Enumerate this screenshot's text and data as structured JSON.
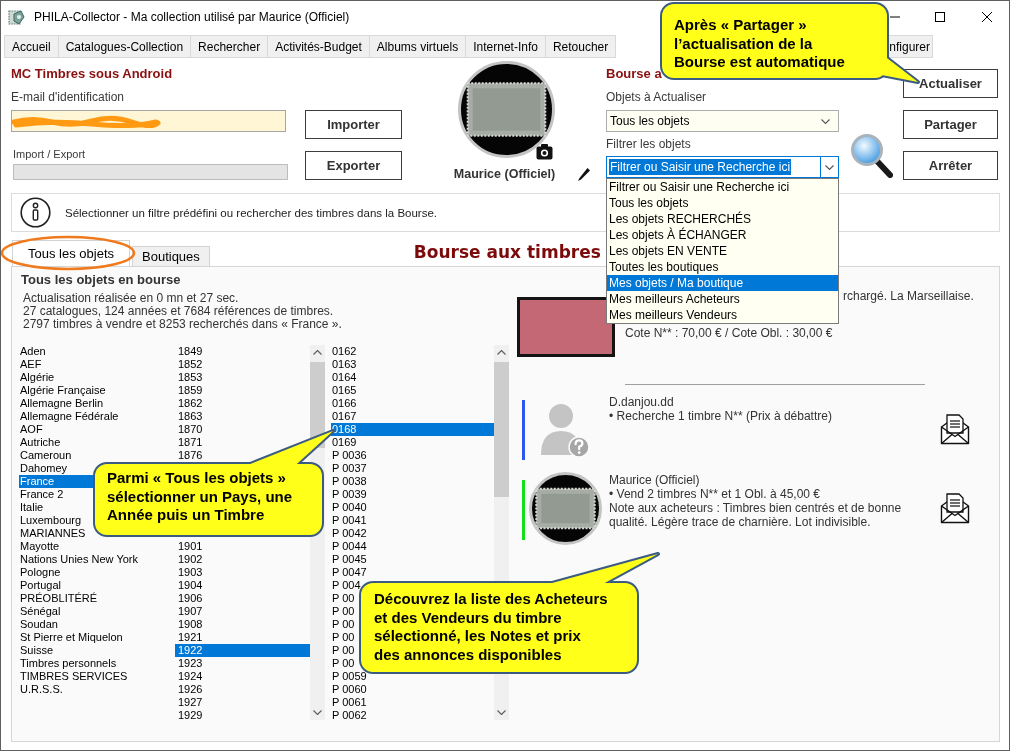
{
  "window": {
    "title": "PHILA-Collector - Ma collection utilisé par Maurice (Officiel)"
  },
  "tabs": [
    {
      "label": "Accueil",
      "selected": false
    },
    {
      "label": "Catalogues-Collection",
      "selected": false
    },
    {
      "label": "Rechercher",
      "selected": false
    },
    {
      "label": "Activités-Budget",
      "selected": false
    },
    {
      "label": "Albums virtuels",
      "selected": false
    },
    {
      "label": "Internet-Info",
      "selected": false
    },
    {
      "label": "Retoucher",
      "selected": false
    },
    {
      "label": "nfigurer",
      "selected": false
    }
  ],
  "android": {
    "title": "MC Timbres sous Android",
    "email_label": "E-mail d'identification",
    "import_export_label": "Import / Export",
    "level": 0,
    "buttons": [
      "Importer",
      "Exporter"
    ]
  },
  "profile": {
    "name": "Maurice (Officiel)"
  },
  "bourse": {
    "title": "Bourse a",
    "objects_label": "Objets à Actualiser",
    "objects_value": "Tous les objets",
    "filter_label": "Filtrer les objets",
    "filter_value": "Filtrer ou Saisir une Recherche ici",
    "filter_highlighted": true,
    "filter_options": [
      {
        "label": "Filtrer ou Saisir une Recherche ici",
        "selected": false
      },
      {
        "label": "Tous les objets",
        "selected": false
      },
      {
        "label": "Les objets RECHERCHÉS",
        "selected": false
      },
      {
        "label": "Les objets À ÉCHANGER",
        "selected": false
      },
      {
        "label": "Les objets EN VENTE",
        "selected": false
      },
      {
        "label": "Toutes les boutiques",
        "selected": false
      },
      {
        "label": "Mes objets / Ma boutique",
        "selected": true
      },
      {
        "label": "Mes meilleurs Acheteurs",
        "selected": false
      },
      {
        "label": "Mes meilleurs Vendeurs",
        "selected": false
      }
    ],
    "buttons": [
      "Actualiser",
      "Partager",
      "Arrêter"
    ]
  },
  "info": "Sélectionner un filtre prédéfini ou rechercher des timbres dans la Bourse.",
  "subtabs": [
    {
      "label": "Tous les objets",
      "selected": true
    },
    {
      "label": "Boutiques",
      "selected": false
    }
  ],
  "heading": "Bourse aux timbres",
  "panel": {
    "title": "Tous les objets en bourse",
    "stats": [
      "Actualisation réalisée en 0 mn et 27 sec.",
      "27 catalogues, 124 années et 7684 références de timbres.",
      "2797 timbres à vendre et 8253 recherchés dans « France »."
    ],
    "countries": [
      {
        "label": "Aden",
        "selected": false
      },
      {
        "label": "AEF",
        "selected": false
      },
      {
        "label": "Algérie",
        "selected": false
      },
      {
        "label": "Algérie Française",
        "selected": false
      },
      {
        "label": "Allemagne Berlin",
        "selected": false
      },
      {
        "label": "Allemagne Fédérale",
        "selected": false
      },
      {
        "label": "AOF",
        "selected": false
      },
      {
        "label": "Autriche",
        "selected": false
      },
      {
        "label": "Cameroun",
        "selected": false
      },
      {
        "label": "Dahomey",
        "selected": false
      },
      {
        "label": "France",
        "selected": true
      },
      {
        "label": "France 2",
        "selected": false
      },
      {
        "label": "Italie",
        "selected": false
      },
      {
        "label": "Luxembourg",
        "selected": false
      },
      {
        "label": "MARIANNES",
        "selected": false
      },
      {
        "label": "Mayotte",
        "selected": false
      },
      {
        "label": "Nations Unies New York",
        "selected": false
      },
      {
        "label": "Pologne",
        "selected": false
      },
      {
        "label": "Portugal",
        "selected": false
      },
      {
        "label": "PRÉOBLITÉRÉ",
        "selected": false
      },
      {
        "label": "Sénégal",
        "selected": false
      },
      {
        "label": "Soudan",
        "selected": false
      },
      {
        "label": "St Pierre et Miquelon",
        "selected": false
      },
      {
        "label": "Suisse",
        "selected": false
      },
      {
        "label": "Timbres personnels",
        "selected": false
      },
      {
        "label": "TIMBRES SERVICES",
        "selected": false
      },
      {
        "label": "U.R.S.S.",
        "selected": false
      }
    ],
    "years": [
      {
        "label": "1849",
        "selected": false
      },
      {
        "label": "1852",
        "selected": false
      },
      {
        "label": "1853",
        "selected": false
      },
      {
        "label": "1859",
        "selected": false
      },
      {
        "label": "1862",
        "selected": false
      },
      {
        "label": "1863",
        "selected": false
      },
      {
        "label": "1870",
        "selected": false
      },
      {
        "label": "1871",
        "selected": false
      },
      {
        "label": "1876",
        "selected": false
      }
    ],
    "years_after_note": [
      {
        "label": "1901",
        "selected": false
      },
      {
        "label": "1902",
        "selected": false
      },
      {
        "label": "1903",
        "selected": false
      },
      {
        "label": "1904",
        "selected": false
      },
      {
        "label": "1906",
        "selected": false
      },
      {
        "label": "1907",
        "selected": false
      },
      {
        "label": "1908",
        "selected": false
      },
      {
        "label": "1921",
        "selected": false
      },
      {
        "label": "1922",
        "selected": true
      },
      {
        "label": "1923",
        "selected": false
      },
      {
        "label": "1924",
        "selected": false
      },
      {
        "label": "1926",
        "selected": false
      },
      {
        "label": "1927",
        "selected": false
      },
      {
        "label": "1929",
        "selected": false
      }
    ],
    "stamps": [
      {
        "label": "0162",
        "selected": false
      },
      {
        "label": "0163",
        "selected": false
      },
      {
        "label": "0164",
        "selected": false
      },
      {
        "label": "0165",
        "selected": false
      },
      {
        "label": "0166",
        "selected": false
      },
      {
        "label": "0167",
        "selected": false
      },
      {
        "label": "0168",
        "selected": true
      },
      {
        "label": "0169",
        "selected": false
      },
      {
        "label": "P 0036",
        "selected": false
      },
      {
        "label": "P 0037",
        "selected": false
      },
      {
        "label": "P 0038",
        "selected": false
      },
      {
        "label": "P 0039",
        "selected": false
      },
      {
        "label": "P 0040",
        "selected": false
      },
      {
        "label": "P 0041",
        "selected": false
      },
      {
        "label": "P 0042",
        "selected": false
      },
      {
        "label": "P 0044",
        "selected": false
      },
      {
        "label": "P 0045",
        "selected": false
      },
      {
        "label": "P 0047",
        "selected": false
      },
      {
        "label": "P 004",
        "selected": false
      },
      {
        "label": "P 00",
        "selected": false
      },
      {
        "label": "P 00",
        "selected": false
      },
      {
        "label": "P 00",
        "selected": false
      },
      {
        "label": "P 00",
        "selected": false
      },
      {
        "label": "P 00",
        "selected": false
      },
      {
        "label": "P 00",
        "selected": false
      },
      {
        "label": "P 0059",
        "selected": false
      },
      {
        "label": "P 0060",
        "selected": false
      },
      {
        "label": "P 0061",
        "selected": false
      },
      {
        "label": "P 0062",
        "selected": false
      }
    ]
  },
  "detail": {
    "description": "rchargé. La Marseillaise.",
    "cote": "Cote N** : 70,00 € / Cote Obl. : 30,00 €",
    "offers": [
      {
        "kind": "silhouette",
        "color": "#2f55f0",
        "name": "D.danjou.dd",
        "line": "• Recherche 1 timbre N** (Prix à débattre)"
      },
      {
        "kind": "stamp",
        "color": "#12e01a",
        "name": "Maurice (Officiel)",
        "line": "• Vend 2 timbres N** et 1 Obl. à 45,00 €",
        "note": "Note aux acheteurs : Timbres bien centrés et de bonne qualité. Légère trace de charnière. Lot indivisible."
      }
    ]
  },
  "callouts": [
    {
      "text": "Après « Partager »\nl’actualisation de la\nBourse est automatique"
    },
    {
      "text": "Parmi « Tous les objets »\nsélectionner un Pays, une\nAnnée puis un Timbre"
    },
    {
      "text": "Découvrez la liste des Acheteurs\net des Vendeurs du timbre\nsélectionné, les Notes et prix\ndes annonces disponibles"
    }
  ]
}
